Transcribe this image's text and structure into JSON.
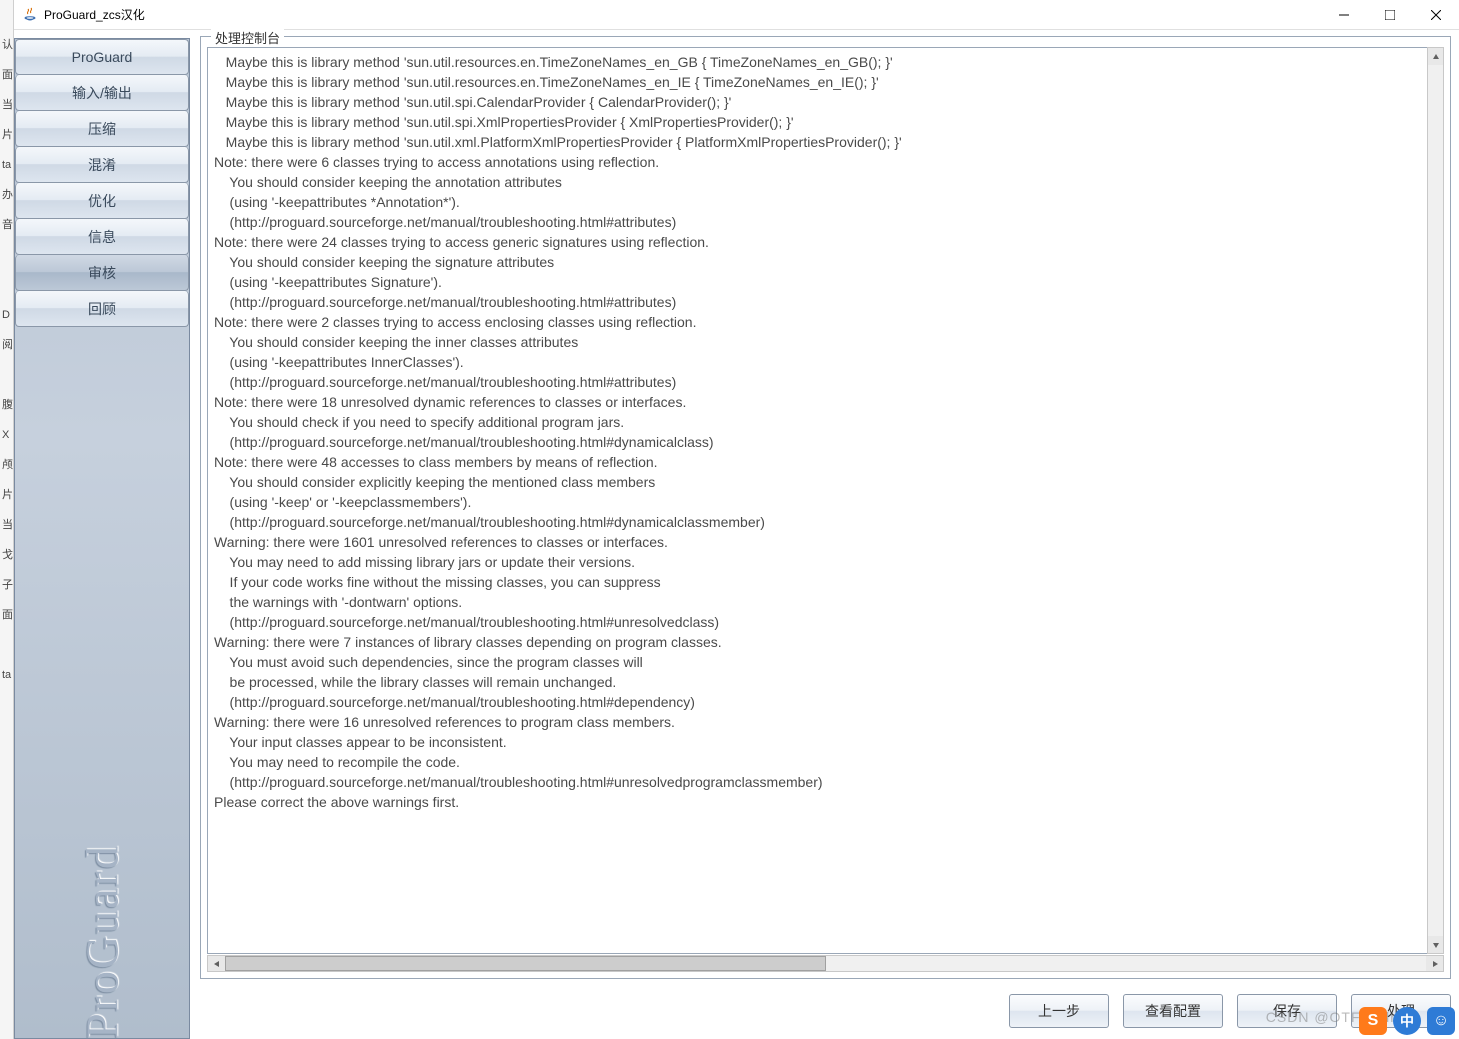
{
  "window": {
    "title": "ProGuard_zcs汉化"
  },
  "gutter": [
    "",
    "认",
    "面",
    "当",
    "片",
    "ta",
    "办",
    "音",
    "",
    "",
    "D",
    "阅",
    "",
    "腹",
    "X",
    "颅",
    "片",
    "当",
    "戈",
    "子",
    "面",
    "",
    "ta"
  ],
  "sidebar": {
    "items": [
      {
        "label": "ProGuard"
      },
      {
        "label": "输入/输出"
      },
      {
        "label": "压缩"
      },
      {
        "label": "混淆"
      },
      {
        "label": "优化"
      },
      {
        "label": "信息"
      },
      {
        "label": "审核"
      },
      {
        "label": "回顾"
      }
    ],
    "selected_index": 6,
    "brand": "ProGuard"
  },
  "groupbox": {
    "legend": "处理控制台"
  },
  "console_lines": [
    "   Maybe this is library method 'sun.util.resources.en.TimeZoneNames_en_GB { TimeZoneNames_en_GB(); }'",
    "   Maybe this is library method 'sun.util.resources.en.TimeZoneNames_en_IE { TimeZoneNames_en_IE(); }'",
    "   Maybe this is library method 'sun.util.spi.CalendarProvider { CalendarProvider(); }'",
    "   Maybe this is library method 'sun.util.spi.XmlPropertiesProvider { XmlPropertiesProvider(); }'",
    "   Maybe this is library method 'sun.util.xml.PlatformXmlPropertiesProvider { PlatformXmlPropertiesProvider(); }'",
    "Note: there were 6 classes trying to access annotations using reflection.",
    "    You should consider keeping the annotation attributes",
    "    (using '-keepattributes *Annotation*').",
    "    (http://proguard.sourceforge.net/manual/troubleshooting.html#attributes)",
    "Note: there were 24 classes trying to access generic signatures using reflection.",
    "    You should consider keeping the signature attributes",
    "    (using '-keepattributes Signature').",
    "    (http://proguard.sourceforge.net/manual/troubleshooting.html#attributes)",
    "Note: there were 2 classes trying to access enclosing classes using reflection.",
    "    You should consider keeping the inner classes attributes",
    "    (using '-keepattributes InnerClasses').",
    "    (http://proguard.sourceforge.net/manual/troubleshooting.html#attributes)",
    "Note: there were 18 unresolved dynamic references to classes or interfaces.",
    "    You should check if you need to specify additional program jars.",
    "    (http://proguard.sourceforge.net/manual/troubleshooting.html#dynamicalclass)",
    "Note: there were 48 accesses to class members by means of reflection.",
    "    You should consider explicitly keeping the mentioned class members",
    "    (using '-keep' or '-keepclassmembers').",
    "    (http://proguard.sourceforge.net/manual/troubleshooting.html#dynamicalclassmember)",
    "Warning: there were 1601 unresolved references to classes or interfaces.",
    "    You may need to add missing library jars or update their versions.",
    "    If your code works fine without the missing classes, you can suppress",
    "    the warnings with '-dontwarn' options.",
    "    (http://proguard.sourceforge.net/manual/troubleshooting.html#unresolvedclass)",
    "Warning: there were 7 instances of library classes depending on program classes.",
    "    You must avoid such dependencies, since the program classes will",
    "    be processed, while the library classes will remain unchanged.",
    "    (http://proguard.sourceforge.net/manual/troubleshooting.html#dependency)",
    "Warning: there were 16 unresolved references to program class members.",
    "    Your input classes appear to be inconsistent.",
    "    You may need to recompile the code.",
    "    (http://proguard.sourceforge.net/manual/troubleshooting.html#unresolvedprogramclassmember)",
    "Please correct the above warnings first."
  ],
  "buttons": {
    "prev": "上一步",
    "view_config": "查看配置",
    "save": "保存",
    "extra": "处理"
  },
  "watermark": "CSDN @OTF csdn",
  "tray": {
    "s": "S",
    "b1": "中",
    "b2": "☺"
  }
}
